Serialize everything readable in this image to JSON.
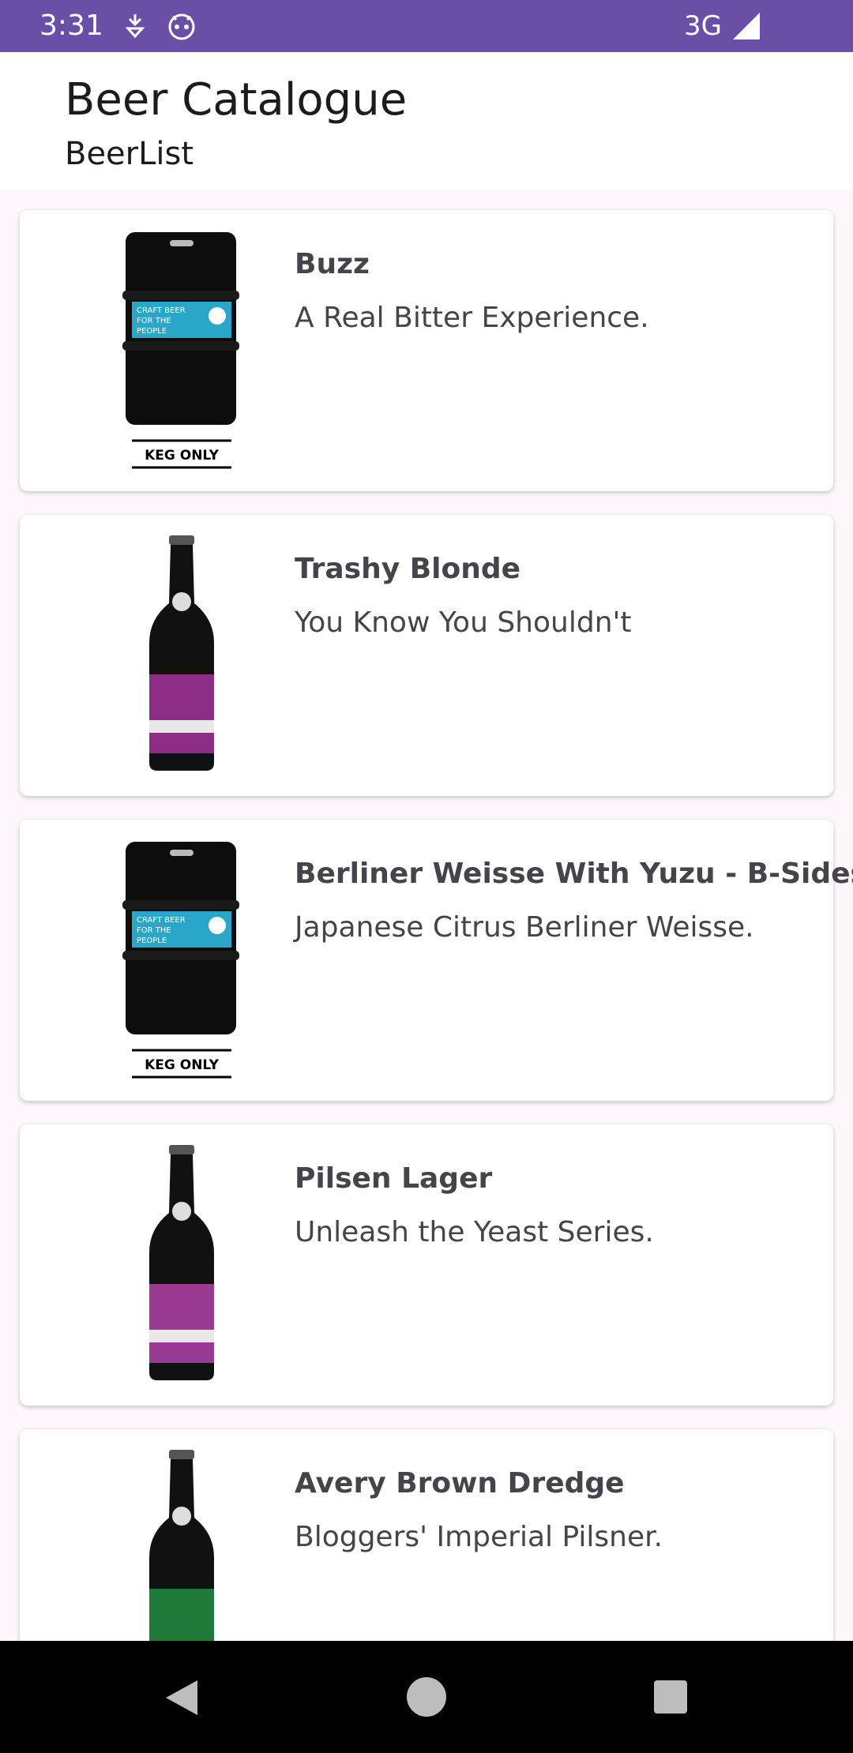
{
  "status_bar": {
    "time": "3:31",
    "network": "3G",
    "icons": [
      "download-arrow-icon",
      "robot-face-icon",
      "signal-icon"
    ]
  },
  "app_bar": {
    "title": "Beer Catalogue",
    "subtitle": "BeerList"
  },
  "beers": [
    {
      "name": "Buzz",
      "tagline": "A Real Bitter Experience.",
      "image": "keg",
      "keg_label": "KEG ONLY",
      "keg_text": [
        "CRAFT BEER",
        "FOR THE",
        "PEOPLE"
      ]
    },
    {
      "name": "Trashy Blonde",
      "tagline": "You Know You Shouldn't",
      "image": "bottle",
      "label_color": "#8e2d86"
    },
    {
      "name": "Berliner Weisse With Yuzu - B-Sides",
      "tagline": "Japanese Citrus Berliner Weisse.",
      "image": "keg",
      "keg_label": "KEG ONLY",
      "keg_text": [
        "CRAFT BEER",
        "FOR THE",
        "PEOPLE"
      ]
    },
    {
      "name": "Pilsen Lager",
      "tagline": "Unleash the Yeast Series.",
      "image": "bottle",
      "label_color": "#9b3a93"
    },
    {
      "name": "Avery Brown Dredge",
      "tagline": "Bloggers' Imperial Pilsner.",
      "image": "bottle",
      "label_color": "#1f7a3a"
    }
  ],
  "colors": {
    "status_bar": "#6a4fa7",
    "keg_band": "#2aa6c9",
    "text": "#45444a"
  },
  "nav_bar": {
    "buttons": [
      "back-icon",
      "home-icon",
      "recents-icon"
    ]
  }
}
